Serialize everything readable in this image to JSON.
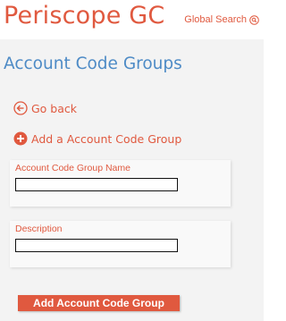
{
  "header": {
    "brand": "Periscope GC",
    "global_search_label": "Global Search",
    "search_icon": "search-icon"
  },
  "page": {
    "title": "Account Code Groups"
  },
  "actions": {
    "go_back_label": "Go back",
    "go_back_icon": "arrow-left-circle-icon",
    "add_label": "Add a Account Code Group",
    "add_icon": "plus-circle-icon"
  },
  "form": {
    "name_label": "Account Code Group Name",
    "name_value": "",
    "description_label": "Description",
    "description_value": "",
    "submit_label": "Add Account Code Group"
  },
  "colors": {
    "brand_orange": "#e0593f",
    "title_blue": "#4e8bc6",
    "content_bg": "#f3f3f3",
    "panel_bg": "#f9f9f9"
  }
}
